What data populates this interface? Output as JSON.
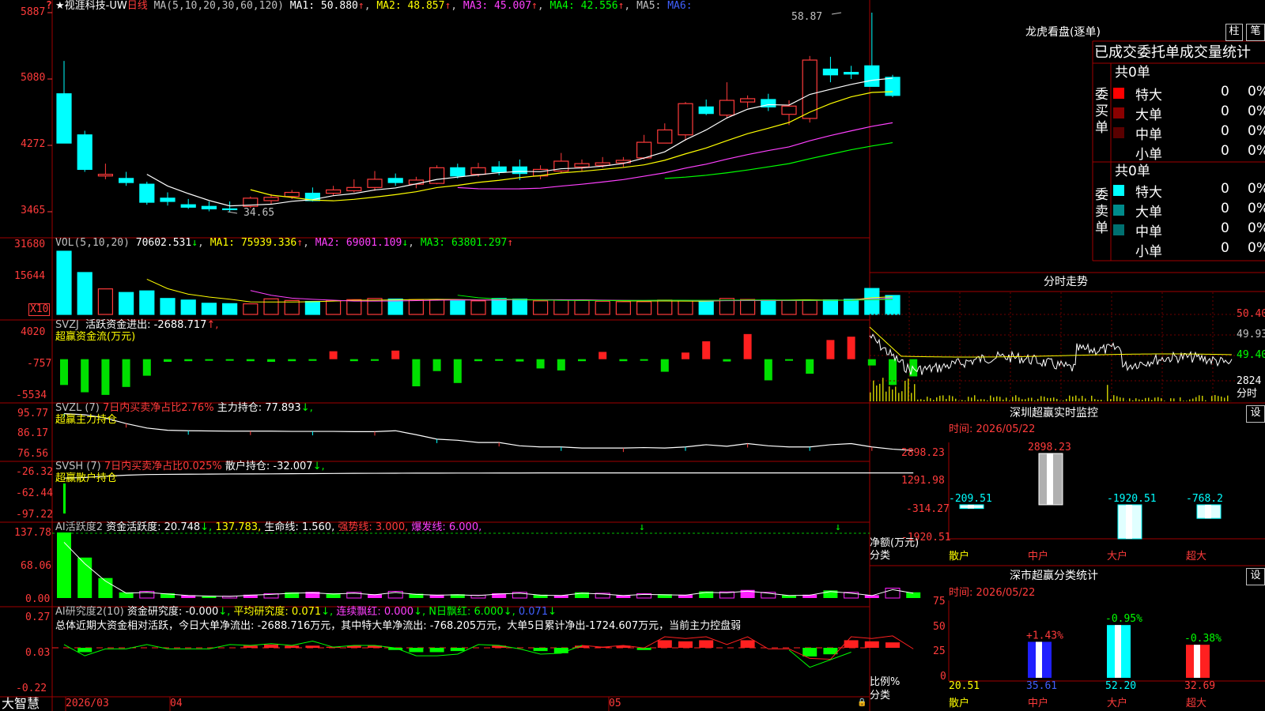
{
  "header": {
    "title": "★视涯科技-UW",
    "period": "日线",
    "ma_label": "MA(5,10,20,30,60,120)",
    "ma1": "MA1: 50.880",
    "ma1_arrow": "↑",
    "ma2": "MA2: 48.857",
    "ma2_arrow": "↑",
    "ma3": "MA3: 45.007",
    "ma3_arrow": "↑",
    "ma4": "MA4: 42.556",
    "ma4_arrow": "↑",
    "ma5": "MA5:",
    "ma6": "MA6:",
    "top_marker": "?"
  },
  "price_axis": [
    "5887",
    "5080",
    "4272",
    "3465"
  ],
  "price_annot": {
    "high": "58.87",
    "low": "34.65"
  },
  "vol": {
    "label": "VOL(5,10,20)",
    "value": "70602.531",
    "arrow": "↓",
    "ma1": "MA1: 75939.336",
    "ma1_arrow": "↑",
    "ma2": "MA2: 69001.109",
    "ma2_arrow": "↓",
    "ma3": "MA3: 63801.297",
    "ma3_arrow": "↑",
    "axis": [
      "31680",
      "15644"
    ],
    "unit": "X10"
  },
  "svzj": {
    "label": "SVZJ",
    "text": "活跃资金进出: -2688.717",
    "arrow": "↑,",
    "sub": "超赢资金流(万元)",
    "axis": [
      "4020",
      "-757",
      "-5534"
    ]
  },
  "svzl": {
    "label": "SVZL (7)",
    "pct": "7日内买卖净占比2.76%",
    "hold": "主力持仓: 77.893",
    "arrow": "↓,",
    "sub": "超赢主力持仓",
    "axis": [
      "95.77",
      "86.17",
      "76.56"
    ]
  },
  "svsh": {
    "label": "SVSH (7)",
    "pct": "7日内买卖净占比0.025%",
    "hold": "散户持仓: -32.007",
    "arrow": "↓,",
    "sub": "超赢散户持仓",
    "axis": [
      "-26.32",
      "-62.44",
      "-97.22"
    ]
  },
  "ai1": {
    "label": "AI活跃度2",
    "text": "资金活跃度: 20.748",
    "arrow": "↓,",
    "v2": "137.783,",
    "life": "生命线: 1.560,",
    "strong": "强势线: 3.000,",
    "burst": "爆发线: 6.000,",
    "axis": [
      "137.78",
      "68.06",
      "0.00"
    ]
  },
  "ai2": {
    "label": "AI研究度2(10)",
    "research": "资金研究度: -0.000",
    "r_arrow": "↓,",
    "avg": "平均研究度: 0.071",
    "avg_arrow": "↓,",
    "red": "连续飘红: 0.000",
    "red_arrow": "↓,",
    "nred": "N日飘红: 6.000",
    "nred_arrow": "↓,",
    "last": "0.071",
    "last_arrow": "↓",
    "summary": "总体近期大资金相对活跃，今日大单净流出: -2688.716万元，其中特大单净流出: -768.205万元，大单5日累计净出-1724.607万元，当前主力控盘弱",
    "axis": [
      "0.27",
      "0.03",
      "-0.22"
    ]
  },
  "date_axis": {
    "brand": "大智慧",
    "d1": "2026/03",
    "d2": "04",
    "d3": "05"
  },
  "dragon": {
    "title": "龙虎看盘(逐单)",
    "btn1": "柱",
    "btn2": "笔",
    "header": "已成交委托单成交量统计",
    "buy": {
      "side": "委买单",
      "total": "共0单",
      "rows": [
        {
          "name": "特大",
          "v": "0",
          "p": "0%",
          "color": "#ff0000"
        },
        {
          "name": "大单",
          "v": "0",
          "p": "0%",
          "color": "#8b0000"
        },
        {
          "name": "中单",
          "v": "0",
          "p": "0%",
          "color": "#5a0000"
        },
        {
          "name": "小单",
          "v": "0",
          "p": "0%",
          "color": ""
        }
      ]
    },
    "sell": {
      "side": "委卖单",
      "total": "共0单",
      "rows": [
        {
          "name": "特大",
          "v": "0",
          "p": "0%",
          "color": "#00ffff"
        },
        {
          "name": "大单",
          "v": "0",
          "p": "0%",
          "color": "#008b8b"
        },
        {
          "name": "中单",
          "v": "0",
          "p": "0%",
          "color": "#007070"
        },
        {
          "name": "小单",
          "v": "0",
          "p": "0%",
          "color": ""
        }
      ]
    }
  },
  "intraday": {
    "title": "分时走势",
    "axis": [
      "50.40",
      "49.93",
      "49.40"
    ],
    "vol_top": "2824",
    "vol_label": "分时"
  },
  "monitor": {
    "title": "深圳超赢实时监控",
    "btn": "设",
    "time": "时间: 2026/05/22",
    "axis": [
      "2898.23",
      "1291.98",
      "-314.27",
      "-1920.51"
    ],
    "ylabel": "净额(万元)",
    "xlabel": "分类",
    "cats": [
      "散户",
      "中户",
      "大户",
      "超大"
    ]
  },
  "classify": {
    "title": "深市超赢分类统计",
    "btn": "设",
    "time": "时间: 2026/05/22",
    "axis": [
      "75",
      "50",
      "25",
      "0"
    ],
    "ylabel": "比例%",
    "xlabel": "分类",
    "cats": [
      "散户",
      "中户",
      "大户",
      "超大"
    ]
  },
  "chart_data": [
    {
      "type": "candlestick",
      "name": "日线",
      "y_unit": "price",
      "ylim": [
        34.0,
        60.5
      ],
      "ohlc": [
        [
          49.0,
          53.0,
          47.5,
          43.0
        ],
        [
          44.0,
          44.5,
          39.5,
          39.8
        ],
        [
          39.0,
          40.5,
          38.6,
          39.2
        ],
        [
          38.7,
          39.5,
          37.8,
          38.2
        ],
        [
          38.0,
          38.3,
          35.5,
          35.8
        ],
        [
          36.3,
          37.0,
          35.4,
          35.9
        ],
        [
          35.5,
          36.2,
          35.0,
          35.2
        ],
        [
          35.3,
          35.9,
          34.7,
          35.0
        ],
        [
          35.0,
          35.9,
          34.65,
          34.9
        ],
        [
          35.3,
          36.5,
          35.1,
          36.3
        ],
        [
          36.0,
          36.8,
          35.6,
          36.4
        ],
        [
          36.5,
          37.3,
          36.2,
          37.0
        ],
        [
          36.9,
          37.6,
          35.9,
          36.0
        ],
        [
          36.9,
          37.8,
          36.6,
          37.3
        ],
        [
          37.2,
          38.6,
          37.0,
          37.6
        ],
        [
          37.6,
          39.6,
          37.2,
          38.6
        ],
        [
          38.7,
          39.3,
          37.8,
          38.2
        ],
        [
          38.0,
          38.9,
          37.5,
          38.5
        ],
        [
          38.1,
          40.3,
          38.0,
          40.0
        ],
        [
          40.0,
          40.5,
          38.7,
          39.0
        ],
        [
          39.2,
          40.6,
          38.9,
          40.0
        ],
        [
          40.1,
          40.8,
          39.1,
          39.5
        ],
        [
          40.1,
          41.0,
          38.5,
          39.3
        ],
        [
          39.0,
          40.3,
          38.6,
          39.8
        ],
        [
          39.6,
          41.8,
          39.4,
          40.8
        ],
        [
          40.1,
          41.0,
          39.6,
          40.5
        ],
        [
          40.3,
          41.3,
          40.0,
          40.6
        ],
        [
          40.6,
          41.3,
          40.1,
          40.9
        ],
        [
          41.2,
          44.0,
          41.0,
          43.1
        ],
        [
          43.0,
          45.4,
          43.0,
          44.6
        ],
        [
          44.0,
          48.0,
          43.3,
          47.8
        ],
        [
          47.4,
          48.3,
          46.4,
          46.6
        ],
        [
          46.4,
          50.4,
          46.0,
          48.2
        ],
        [
          48.0,
          48.8,
          47.3,
          48.4
        ],
        [
          48.3,
          49.0,
          46.9,
          47.4
        ],
        [
          46.5,
          48.2,
          45.2,
          47.5
        ],
        [
          46.0,
          53.6,
          45.5,
          53.1
        ],
        [
          52.0,
          53.5,
          50.4,
          51.3
        ],
        [
          51.6,
          52.4,
          50.8,
          51.4
        ],
        [
          52.4,
          58.87,
          49.9,
          49.9
        ],
        [
          51.0,
          51.3,
          48.6,
          48.8
        ]
      ],
      "ma_series": [
        {
          "name": "MA1",
          "color": "#ffffff"
        },
        {
          "name": "MA2",
          "color": "#ffff00"
        },
        {
          "name": "MA3",
          "color": "#ff40ff"
        },
        {
          "name": "MA4",
          "color": "#00ff00"
        }
      ]
    },
    {
      "type": "bar",
      "name": "VOL(5,10,20)",
      "unit": "X10",
      "ylim": [
        0,
        35000
      ],
      "values": [
        31680,
        21000,
        12800,
        11000,
        11800,
        8000,
        7200,
        5600,
        5400,
        5300,
        7800,
        7000,
        6500,
        6800,
        7400,
        8000,
        7700,
        7400,
        7400,
        6800,
        6800,
        8000,
        7700,
        6800,
        7200,
        7000,
        6600,
        6400,
        6400,
        7200,
        6800,
        6400,
        8000,
        7500,
        7200,
        7000,
        7000,
        7300,
        7600,
        13000,
        9500
      ]
    },
    {
      "type": "bar",
      "name": "超赢资金流(万元)",
      "ylim": [
        -5534,
        4020
      ],
      "values": [
        -3900,
        -5000,
        -5400,
        -4200,
        -2500,
        -400,
        -300,
        -200,
        -150,
        -300,
        -400,
        -300,
        -250,
        1200,
        -300,
        -250,
        1300,
        -4100,
        -1800,
        -3600,
        -300,
        -250,
        -350,
        -1400,
        -1700,
        -300,
        1100,
        -300,
        -200,
        -1900,
        1000,
        2700,
        -350,
        3800,
        -3200,
        -200,
        -2200,
        2900,
        3400,
        -950,
        -3900,
        -2600
      ]
    },
    {
      "type": "line",
      "name": "超赢主力持仓",
      "ylim": [
        76.56,
        95.77
      ],
      "values": [
        94.5,
        94.0,
        92.5,
        90.0,
        88.0,
        87.0,
        86.8,
        86.7,
        86.6,
        86.6,
        86.6,
        86.5,
        86.5,
        86.5,
        86.4,
        86.4,
        86.8,
        85.0,
        83.0,
        82.5,
        81.5,
        81.5,
        80.0,
        79.5,
        79.5,
        79.0,
        79.0,
        79.0,
        79.2,
        79.0,
        79.5,
        80.5,
        79.8,
        81.0,
        80.0,
        79.5,
        79.5,
        80.5,
        81.0,
        79.5,
        78.5,
        77.9
      ]
    },
    {
      "type": "line",
      "name": "超赢散户持仓",
      "ylim": [
        -97.22,
        -26.32
      ],
      "values": [
        -40.0,
        -39.0,
        -37.0,
        -35.5,
        -34.5,
        -34.2,
        -34.0,
        -33.8,
        -33.6,
        -33.5,
        -33.4,
        -33.2,
        -33.0,
        -32.8,
        -32.6,
        -32.5,
        -32.4,
        -32.3,
        -32.3,
        -32.2,
        -32.2,
        -32.1,
        -32.1,
        -32.0,
        -32.0,
        -32.0,
        -32.0,
        -32.0,
        -32.0,
        -32.0,
        -32.0,
        -32.0,
        -32.0,
        -32.0,
        -32.0,
        -32.0,
        -32.0,
        -32.0,
        -32.0,
        -32.0,
        -32.0,
        -32.0
      ]
    },
    {
      "type": "bar",
      "name": "AI活跃度2",
      "ylim": [
        0,
        137.78
      ],
      "values": [
        137.78,
        85,
        42,
        12,
        14,
        10,
        6,
        5,
        4,
        7,
        9,
        12,
        13,
        10,
        12,
        8,
        14,
        9,
        7,
        8,
        6,
        10,
        12,
        7,
        6,
        12,
        10,
        6,
        9,
        8,
        7,
        14,
        13,
        17,
        12,
        6,
        7,
        16,
        12,
        6,
        20.748,
        12
      ]
    },
    {
      "type": "bar",
      "name": "AI研究度2(10)",
      "ylim": [
        -0.22,
        0.27
      ],
      "values": [
        0,
        -0.04,
        0,
        0,
        0,
        0,
        0,
        0,
        0,
        0.02,
        0.03,
        0.02,
        0.02,
        0.01,
        0.02,
        0.02,
        -0.02,
        -0.04,
        -0.04,
        -0.03,
        0,
        0.02,
        0,
        -0.03,
        -0.05,
        0.02,
        0.01,
        0.02,
        -0.02,
        0.07,
        0.06,
        0.07,
        0,
        0.07,
        0,
        0,
        -0.08,
        -0.06,
        0.07,
        0.06,
        0.05,
        0
      ]
    },
    {
      "type": "line",
      "name": "分时走势",
      "ylim": [
        49.0,
        50.6
      ],
      "ref": 49.4
    },
    {
      "type": "bar",
      "name": "深圳超赢实时监控",
      "categories": [
        "散户",
        "中户",
        "大户",
        "超大"
      ],
      "values": [
        -209.51,
        2898.23,
        -1920.51,
        -768.2
      ],
      "ylim": [
        -1920.51,
        2898.23
      ]
    },
    {
      "type": "bar",
      "name": "深市超赢分类统计",
      "categories": [
        "散户",
        "中户",
        "大户",
        "超大"
      ],
      "values": [
        20.51,
        35.61,
        52.2,
        32.69
      ],
      "changes": [
        "",
        "+1.43%",
        "-0.95%",
        "-0.38%"
      ],
      "ylim": [
        0,
        75
      ]
    }
  ]
}
